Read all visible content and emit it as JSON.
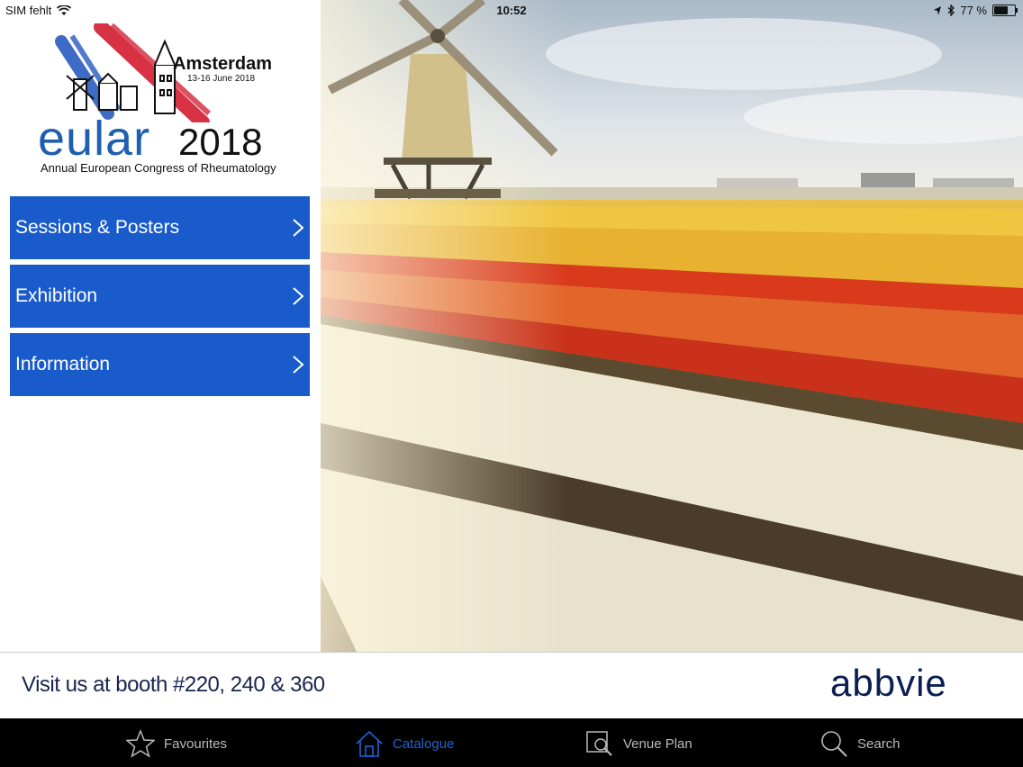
{
  "status_bar": {
    "carrier": "SIM fehlt",
    "time": "10:52",
    "battery": "77 %",
    "battery_level": 0.77
  },
  "logo": {
    "city": "Amsterdam",
    "dates": "13-16 June 2018",
    "word": "eular",
    "year": "2018",
    "subtitle": "Annual European Congress of Rheumatology"
  },
  "menu": [
    {
      "label": "Sessions & Posters"
    },
    {
      "label": "Exhibition"
    },
    {
      "label": "Information"
    }
  ],
  "banner": {
    "visit": "Visit us at booth #220, 240 & 360",
    "brand": "abbvie"
  },
  "tabs": [
    {
      "label": "Favourites",
      "icon": "star-icon"
    },
    {
      "label": "Catalogue",
      "icon": "home-icon",
      "active": true
    },
    {
      "label": "Venue Plan",
      "icon": "map-search-icon"
    },
    {
      "label": "Search",
      "icon": "magnifier-icon"
    }
  ],
  "colors": {
    "menu_blue": "#1a5bcc",
    "active_tab": "#1e63d6",
    "brand_navy": "#0b1f52"
  }
}
